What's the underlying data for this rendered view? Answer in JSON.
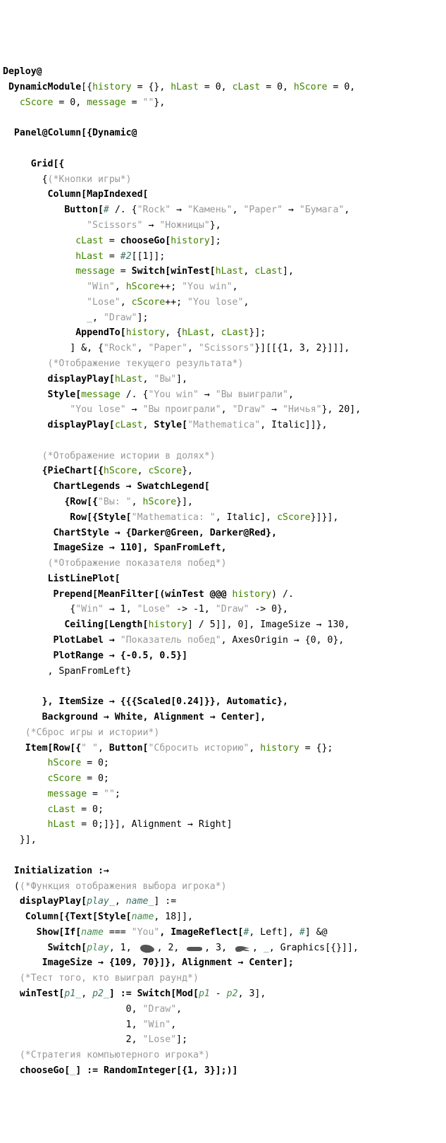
{
  "t": {
    "l1a": "Deploy@",
    "l2a": "DynamicModule",
    "l2b": "[{",
    "l2c": "history",
    "l2d": " = {}, ",
    "l2e": "hLast",
    "l2f": " = 0, ",
    "l2g": "cLast",
    "l2h": " = 0, ",
    "l2i": "hScore",
    "l2j": " = 0,",
    "l3a": "cScore",
    "l3b": " = 0, ",
    "l3c": "message",
    "l3d": " = ",
    "l3e": "\"\"",
    "l3f": "},",
    "l4a": "Panel@Column[{Dynamic@",
    "l5a": "Grid[{",
    "l6a": "{",
    "l6b": "(*Кнопки игры*)",
    "l7a": "Column[MapIndexed[",
    "l8a": "Button[",
    "l8b": "#",
    "l8c": " /. {",
    "l8d": "\"Rock\"",
    "l8e": " → ",
    "l8f": "\"Камень\"",
    "l8g": ", ",
    "l8h": "\"Paper\"",
    "l8i": " → ",
    "l8j": "\"Бумага\"",
    "l8k": ",",
    "l9a": "\"Scissors\"",
    "l9b": " → ",
    "l9c": "\"Ножницы\"",
    "l9d": "},",
    "l10a": "cLast",
    "l10b": " = ",
    "l10c": "chooseGo[",
    "l10d": "history",
    "l10e": "];",
    "l11a": "hLast",
    "l11b": " = ",
    "l11c": "#2",
    "l11d": "[[1]];",
    "l12a": "message",
    "l12b": " = ",
    "l12c": "Switch[winTest[",
    "l12d": "hLast",
    "l12e": ", ",
    "l12f": "cLast",
    "l12g": "],",
    "l13a": "\"Win\"",
    "l13b": ", ",
    "l13c": "hScore",
    "l13d": "++; ",
    "l13e": "\"You win\"",
    "l13f": ",",
    "l14a": "\"Lose\"",
    "l14b": ", ",
    "l14c": "cScore",
    "l14d": "++; ",
    "l14e": "\"You lose\"",
    "l14f": ",",
    "l15a": "_",
    "l15b": ", ",
    "l15c": "\"Draw\"",
    "l15d": "];",
    "l16a": "AppendTo[",
    "l16b": "history",
    "l16c": ", {",
    "l16d": "hLast",
    "l16e": ", ",
    "l16f": "cLast",
    "l16g": "}];",
    "l17a": "] &, {",
    "l17b": "\"Rock\"",
    "l17c": ", ",
    "l17d": "\"Paper\"",
    "l17e": ", ",
    "l17f": "\"Scissors\"",
    "l17g": "}][[{1, 3, 2}]]],",
    "l18a": "(*Отображение текущего результата*)",
    "l19a": "displayPlay[",
    "l19b": "hLast",
    "l19c": ", ",
    "l19d": "\"Вы\"",
    "l19e": "],",
    "l20a": "Style[",
    "l20b": "message",
    "l20c": " /. {",
    "l20d": "\"You win\"",
    "l20e": " → ",
    "l20f": "\"Вы выиграли\"",
    "l20g": ",",
    "l21a": "\"You lose\"",
    "l21b": " → ",
    "l21c": "\"Вы проиграли\"",
    "l21d": ", ",
    "l21e": "\"Draw\"",
    "l21f": " → ",
    "l21g": "\"Ничья\"",
    "l21h": "}, 20],",
    "l22a": "displayPlay[",
    "l22b": "cLast",
    "l22c": ", ",
    "l22d": "Style[",
    "l22e": "\"Mathematica\"",
    "l22f": ", Italic]]},",
    "l23a": "(*Отображение истории в долях*)",
    "l24a": "{PieChart[{",
    "l24b": "hScore",
    "l24c": ", ",
    "l24d": "cScore",
    "l24e": "},",
    "l25a": "ChartLegends → SwatchLegend[",
    "l26a": "{Row[{",
    "l26b": "\"Вы: \"",
    "l26c": ", ",
    "l26d": "hScore",
    "l26e": "}],",
    "l27a": "Row[{Style[",
    "l27b": "\"Mathematica: \"",
    "l27c": ", Italic], ",
    "l27d": "cScore",
    "l27e": "}]}],",
    "l28a": "ChartStyle → {Darker@Green, Darker@Red},",
    "l29a": "ImageSize → 110], SpanFromLeft,",
    "l30a": "(*Отображение показателя побед*)",
    "l31a": "ListLinePlot[",
    "l32a": "Prepend[MeanFilter[(winTest @@@ ",
    "l32b": "history",
    "l32c": ") /.",
    "l33a": "{",
    "l33b": "\"Win\"",
    "l33c": " → 1, ",
    "l33d": "\"Lose\"",
    "l33e": " -> -1, ",
    "l33f": "\"Draw\"",
    "l33g": " -> 0},",
    "l34a": "Ceiling[Length[",
    "l34b": "history",
    "l34c": "] / 5]], 0], ImageSize → 130,",
    "l35a": "PlotLabel → ",
    "l35b": "\"Показатель побед\"",
    "l35c": ", AxesOrigin → {0, 0},",
    "l36a": "PlotRange → {-0.5, 0.5}]",
    "l37a": ", SpanFromLeft}",
    "l38a": "}, ItemSize → {{{Scaled[0.24]}}, Automatic},",
    "l39a": "Background → White, Alignment → Center],",
    "l40a": "(*Сброс игры и истории*)",
    "l41a": "Item[Row[{",
    "l41b": "\" \"",
    "l41c": ", ",
    "l41d": "Button[",
    "l41e": "\"Сбросить историю\"",
    "l41f": ", ",
    "l41g": "history",
    "l41h": " = {};",
    "l42a": "hScore",
    "l42b": " = 0;",
    "l43a": "cScore",
    "l43b": " = 0;",
    "l44a": "message",
    "l44b": " = ",
    "l44c": "\"\"",
    "l44d": ";",
    "l45a": "cLast",
    "l45b": " = 0;",
    "l46a": "hLast",
    "l46b": " = 0;]}], Alignment → Right]",
    "l47a": "}],",
    "l48a": "Initialization :→",
    "l49a": "(",
    "l49b": "(*Функция отображения выбора игрока*)",
    "l50a": "displayPlay[",
    "l50b": "play_",
    "l50c": ", ",
    "l50d": "name_",
    "l50e": "] :=",
    "l51a": "Column[{Text[Style[",
    "l51b": "name",
    "l51c": ", 18]],",
    "l52a": "Show[If[",
    "l52b": "name",
    "l52c": " === ",
    "l52d": "\"You\"",
    "l52e": ", ImageReflect[",
    "l52f": "#",
    "l52g": ", Left], ",
    "l52h": "#",
    "l52i": "] &@",
    "l53a": "Switch[",
    "l53b": "play",
    "l53c": ", 1, ",
    "l53d": ", 2, ",
    "l53e": ", 3, ",
    "l53f": ", ",
    "l53g": "_",
    "l53h": ", Graphics[{}]],",
    "l54a": "ImageSize → {109, 70}]}, Alignment → Center];",
    "l55a": "(*Тест того, кто выиграл раунд*)",
    "l56a": "winTest[",
    "l56b": "p1_",
    "l56c": ", ",
    "l56d": "p2_",
    "l56e": "] := Switch[Mod[",
    "l56f": "p1",
    "l56g": " - ",
    "l56h": "p2",
    "l56i": ", 3],",
    "l57a": "0, ",
    "l57b": "\"Draw\"",
    "l57c": ",",
    "l58a": "1, ",
    "l58b": "\"Win\"",
    "l58c": ",",
    "l59a": "2, ",
    "l59b": "\"Lose\"",
    "l59c": "];",
    "l60a": "(*Стратегия компьютерного игрока*)",
    "l61a": "chooseGo[",
    "l61b": "_",
    "l61c": "] := RandomInteger[{1, 3}];)]"
  }
}
